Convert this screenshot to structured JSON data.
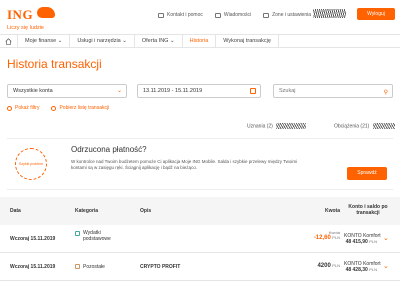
{
  "brand": {
    "name": "ING",
    "slogan": "Liczy się ludzie"
  },
  "top_links": [
    {
      "label": "Kontakt i pomoc"
    },
    {
      "label": "Wiadomości"
    },
    {
      "label": "Zone i ustawienia"
    }
  ],
  "logout_label": "Wyloguj",
  "nav": {
    "items": [
      {
        "label": "Moje finanse ⌄"
      },
      {
        "label": "Usługi i narzędzia ⌄"
      },
      {
        "label": "Oferta ING ⌄"
      },
      {
        "label": "Historia"
      },
      {
        "label": "Wykonaj transakcję"
      }
    ]
  },
  "page_title": "Historia transakcji",
  "filters": {
    "account": "Wszystkie konta",
    "date_range": "13.11.2019 - 15.11.2019",
    "search_placeholder": "Szukaj"
  },
  "actions": {
    "hide_filters": "Pokaż filtry",
    "download": "Pobierz listę transakcji"
  },
  "counts": {
    "inflows": "Uznania (2)",
    "outflows": "Obciążenia (21)"
  },
  "rejected": {
    "icon_text": "Szybki problem",
    "title": "Odrzucona płatność?",
    "description": "W kontrolce nad Twoim budżetem pomoże Ci aplikacja Moje ING Mobile. Salda i szybkie przelewy między Twoimi kontami są w zasięgu ręki. Ściągnij aplikację i bądź na bieżąco.",
    "button": "Sprawdź"
  },
  "table": {
    "headers": {
      "date": "Data",
      "category": "Kategoria",
      "description": "Opis",
      "amount": "Kwota",
      "account": "Konto i saldo po transakcji"
    },
    "rows": [
      {
        "date": "Wczoraj 15.11.2019",
        "category": "Wydatki podstawowe",
        "description": "",
        "amount_label": "Kwota",
        "amount": "-12,60",
        "currency": "PLN",
        "account": "KONTO Komfort",
        "balance": "48 415,90",
        "balance_currency": "PLN"
      },
      {
        "date": "Wczoraj 15.11.2019",
        "category": "Pozostałe",
        "description": "CRYPTO PROFIT",
        "amount_label": "",
        "amount": "4200",
        "currency": "PLN",
        "account": "KONTO Komfort",
        "balance": "48 428,30",
        "balance_currency": "PLN"
      }
    ]
  },
  "colors": {
    "accent": "#ff6200"
  }
}
